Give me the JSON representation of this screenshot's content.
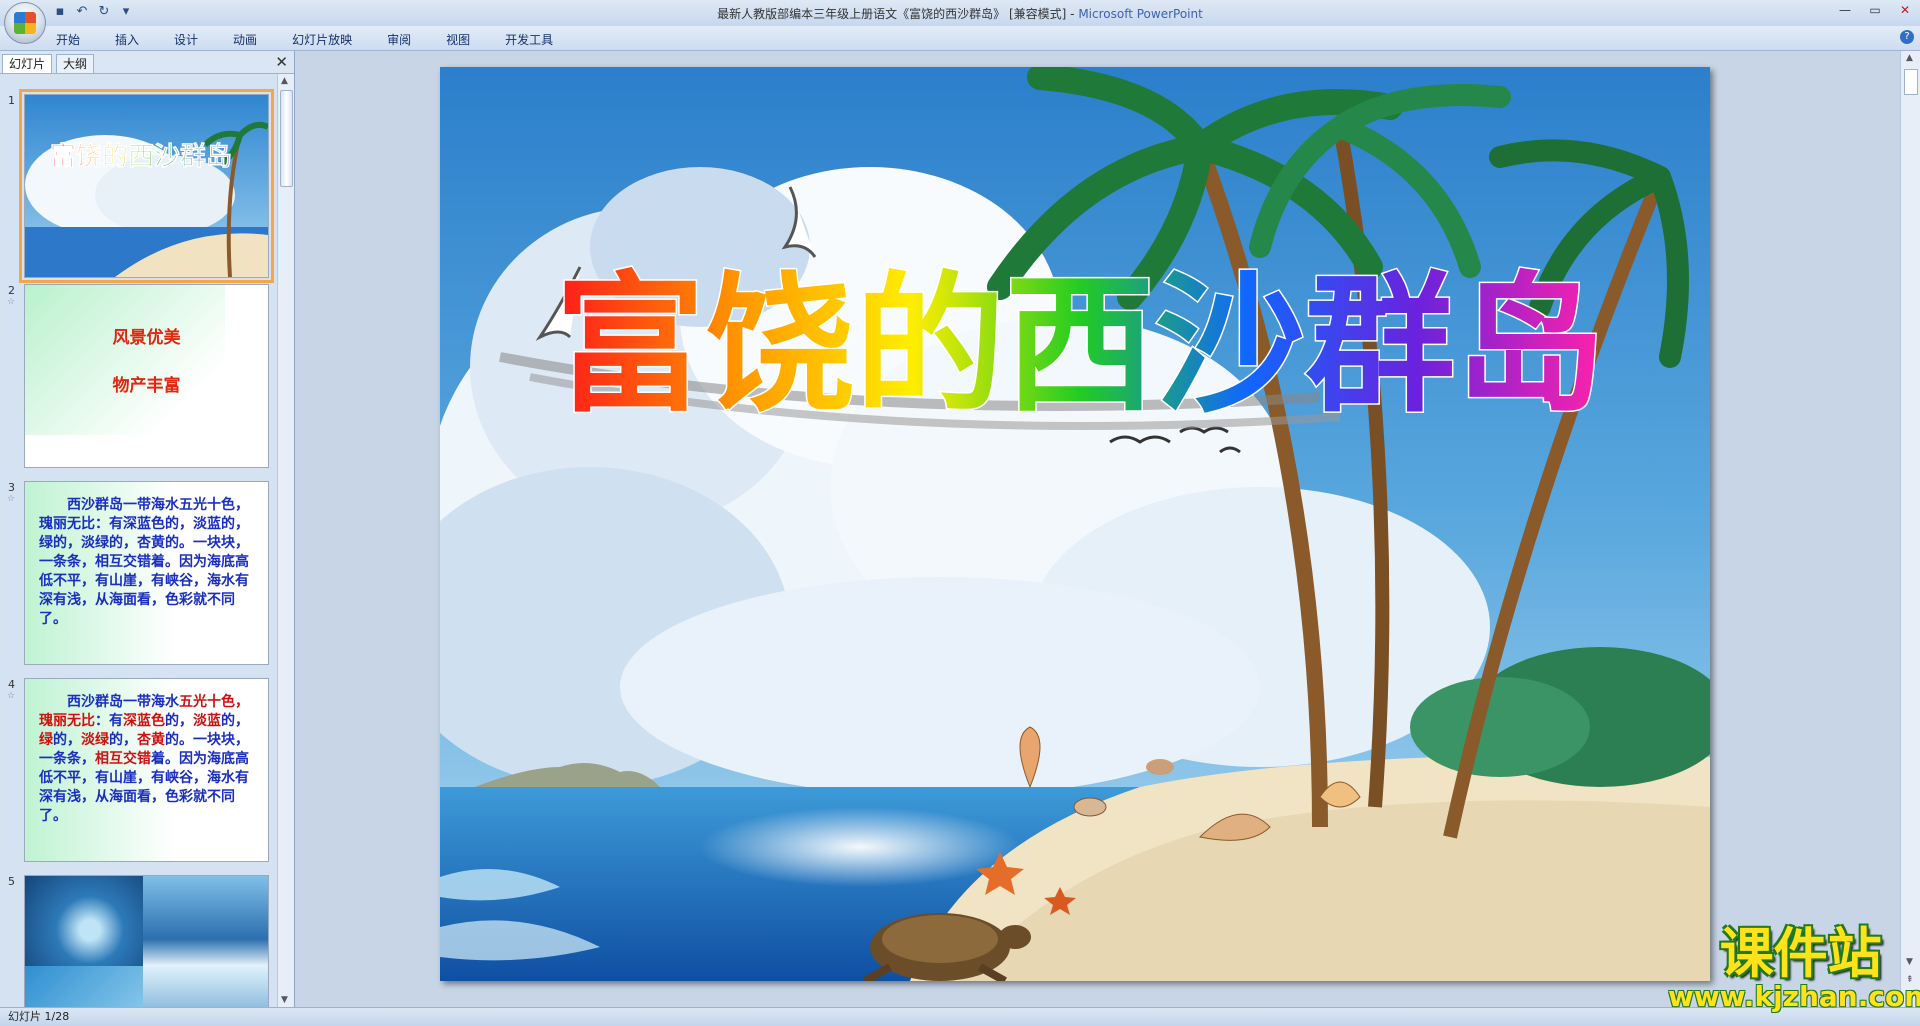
{
  "window": {
    "title": "最新人教版部编本三年级上册语文《富饶的西沙群岛》 [兼容模式] - ",
    "app_name": "Microsoft PowerPoint"
  },
  "ribbon": {
    "tabs": [
      "开始",
      "插入",
      "设计",
      "动画",
      "幻灯片放映",
      "审阅",
      "视图",
      "开发工具"
    ]
  },
  "left_panel": {
    "tab_slides": "幻灯片",
    "tab_outline": "大纲",
    "thumbnails": [
      {
        "num": "1",
        "title": "富饶的西沙群岛"
      },
      {
        "num": "2",
        "line1": "风景优美",
        "line2": "物产丰富"
      },
      {
        "num": "3",
        "text": "西沙群岛一带海水五光十色，瑰丽无比：有深蓝色的，淡蓝的，绿的，淡绿的，杏黄的。一块块，一条条，相互交错着。因为海底高低不平，有山崖，有峡谷，海水有深有浅，从海面看，色彩就不同了。"
      },
      {
        "num": "4",
        "p1": "西沙群岛一带海水",
        "p2": "五光十",
        "p3": "色，",
        "p4": "瑰丽无比",
        "p5": "：有",
        "p6": "深蓝色",
        "p7": "的，",
        "p8": "淡蓝",
        "p9": "的，",
        "p10": "绿",
        "p11": "的，",
        "p12": "淡绿",
        "p13": "的，",
        "p14": "杏黄",
        "p15": "的。一块块，一条条，",
        "p16": "相互交错",
        "p17": "着。因为海底高低不平，有山崖，有峡谷，海水有深有浅，从海面看，色彩就不同了。"
      },
      {
        "num": "5"
      }
    ]
  },
  "slide": {
    "title": "富饶的西沙群岛"
  },
  "watermark": {
    "cn": "课件站",
    "url": "www.kjzhan.com"
  },
  "status": {
    "slide_counter": "幻灯片 1/28"
  },
  "colors": {
    "sky": "#3f8fd2",
    "sea": "#1f72c4",
    "sand": "#f2e6c8",
    "palm": "#1f7a3a"
  }
}
